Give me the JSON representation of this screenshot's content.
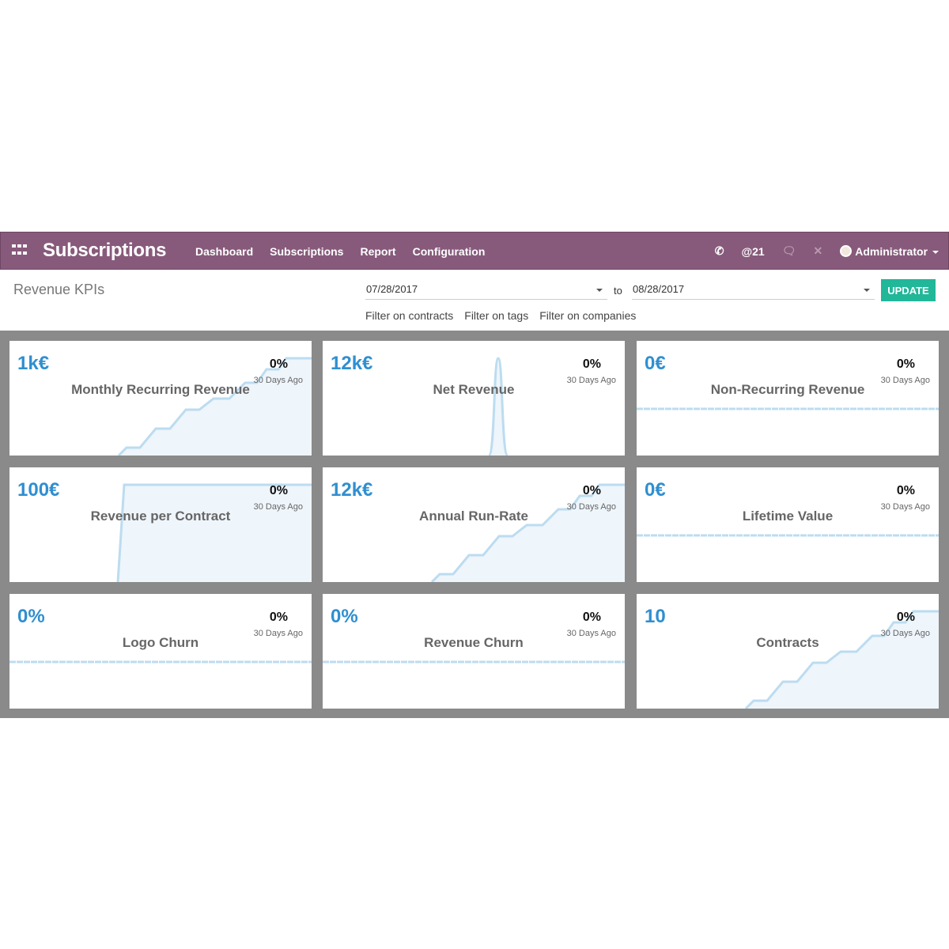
{
  "navbar": {
    "app_title": "Subscriptions",
    "menu": [
      "Dashboard",
      "Subscriptions",
      "Report",
      "Configuration"
    ],
    "mentions": "@21",
    "user": "Administrator",
    "color": "#875A7B"
  },
  "page": {
    "title": "Revenue KPIs",
    "date_from": "07/28/2017",
    "to_label": "to",
    "date_to": "08/28/2017",
    "update_label": "UPDATE",
    "filters": [
      "Filter on contracts",
      "Filter on tags",
      "Filter on companies"
    ]
  },
  "cards": [
    {
      "value": "1k€",
      "name": "Monthly Recurring Revenue",
      "pct": "0%",
      "ago": "30 Days Ago",
      "trend": "steps"
    },
    {
      "value": "12k€",
      "name": "Net Revenue",
      "pct": "0%",
      "ago": "30 Days Ago",
      "trend": "spike"
    },
    {
      "value": "0€",
      "name": "Non-Recurring Revenue",
      "pct": "0%",
      "ago": "30 Days Ago",
      "trend": "flat"
    },
    {
      "value": "100€",
      "name": "Revenue per Contract",
      "pct": "0%",
      "ago": "30 Days Ago",
      "trend": "jump"
    },
    {
      "value": "12k€",
      "name": "Annual Run-Rate",
      "pct": "0%",
      "ago": "30 Days Ago",
      "trend": "steps"
    },
    {
      "value": "0€",
      "name": "Lifetime Value",
      "pct": "0%",
      "ago": "30 Days Ago",
      "trend": "flat"
    },
    {
      "value": "0%",
      "name": "Logo Churn",
      "pct": "0%",
      "ago": "30 Days Ago",
      "trend": "flat"
    },
    {
      "value": "0%",
      "name": "Revenue Churn",
      "pct": "0%",
      "ago": "30 Days Ago",
      "trend": "flat"
    },
    {
      "value": "10",
      "name": "Contracts",
      "pct": "0%",
      "ago": "30 Days Ago",
      "trend": "steps"
    }
  ]
}
